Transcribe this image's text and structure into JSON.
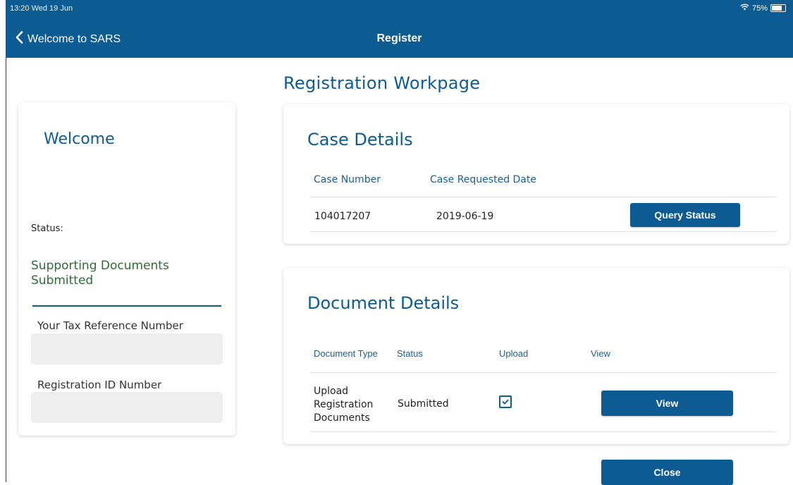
{
  "status_bar": {
    "time": "13:20  Wed 19 Jun",
    "battery": "75%"
  },
  "nav": {
    "back_label": "Welcome to SARS",
    "title": "Register"
  },
  "page": {
    "title": "Registration Workpage"
  },
  "sidebar": {
    "welcome": "Welcome",
    "status_label": "Status:",
    "status_value": "Supporting Documents Submitted",
    "tax_ref_label": "Your Tax Reference Number",
    "tax_ref_value": "",
    "reg_id_label": "Registration ID Number",
    "reg_id_value": ""
  },
  "case_details": {
    "title": "Case Details",
    "columns": [
      "Case Number",
      "Case Requested Date"
    ],
    "rows": [
      {
        "case_number": "104017207",
        "requested_date": "2019-06-19"
      }
    ],
    "query_button": "Query Status"
  },
  "document_details": {
    "title": "Document Details",
    "columns": [
      "Document Type",
      "Status",
      "Upload",
      "View"
    ],
    "rows": [
      {
        "doc_type_lines": [
          "Upload",
          "Registration",
          "Documents"
        ],
        "status": "Submitted",
        "uploaded": true,
        "view_button": "View"
      }
    ]
  },
  "close_button": "Close",
  "colors": {
    "brand": "#0d5b93",
    "status_green": "#2f6b3a",
    "field_bg": "#efefef"
  },
  "icons": {
    "back": "chevron-left-icon",
    "wifi": "wifi-icon",
    "battery": "battery-icon",
    "checkbox": "checkbox-checked-icon"
  }
}
